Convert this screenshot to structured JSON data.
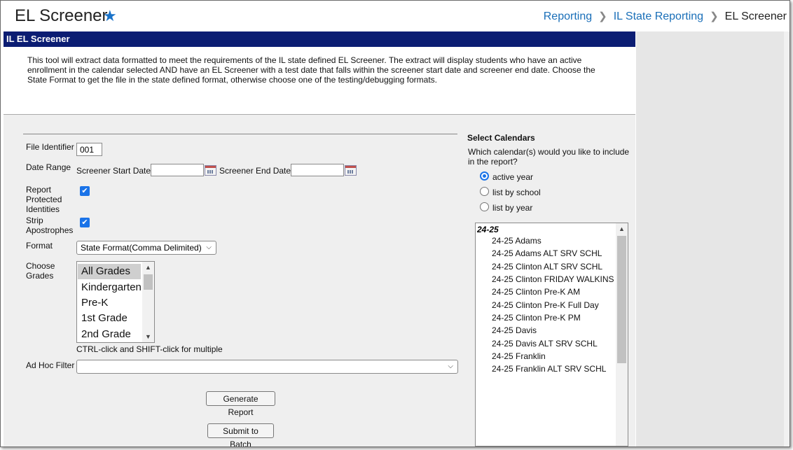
{
  "header": {
    "title": "EL Screener",
    "breadcrumb": [
      "Reporting",
      "IL State Reporting",
      "EL Screener"
    ]
  },
  "panel": {
    "title": "IL EL Screener",
    "description": "This tool will extract data formatted to meet the requirements of the IL state defined EL Screener. The extract will display students who have an active enrollment in the calendar selected AND have an EL Screener with a test date that falls within the screener start date and screener end date. Choose the State Format to get the file in the state defined format, otherwise choose one of the testing/debugging formats."
  },
  "form": {
    "file_identifier_label": "File Identifier",
    "file_identifier_value": "001",
    "date_range_label": "Date Range",
    "start_date_label": "Screener Start Date",
    "start_date_value": "",
    "end_date_label": "Screener End Date",
    "end_date_value": "",
    "protected_label_1": "Report",
    "protected_label_2": "Protected",
    "protected_label_3": "Identities",
    "protected_checked": true,
    "strip_label_1": "Strip",
    "strip_label_2": "Apostrophes",
    "strip_checked": true,
    "format_label": "Format",
    "format_value": "State Format(Comma Delimited)",
    "grades_label_1": "Choose",
    "grades_label_2": "Grades",
    "grades": [
      "All Grades",
      "Kindergarten",
      "Pre-K",
      "1st Grade",
      "2nd Grade"
    ],
    "grades_selected": "All Grades",
    "grades_hint": "CTRL-click and SHIFT-click for multiple",
    "adhoc_label": "Ad Hoc Filter",
    "adhoc_value": "",
    "generate_button": "Generate Report",
    "batch_button": "Submit to Batch"
  },
  "calendars": {
    "title": "Select Calendars",
    "question_1": "Which calendar(s) would you like to include",
    "question_2": "in the report?",
    "options": [
      "active year",
      "list by school",
      "list by year"
    ],
    "selected_option": "active year",
    "group": "24-25",
    "items": [
      "24-25 Adams",
      "24-25 Adams ALT SRV SCHL",
      "24-25 Clinton ALT SRV SCHL",
      "24-25 Clinton FRIDAY WALKINS",
      "24-25 Clinton Pre-K AM",
      "24-25 Clinton Pre-K Full Day",
      "24-25 Clinton Pre-K PM",
      "24-25 Davis",
      "24-25 Davis ALT SRV SCHL",
      "24-25 Franklin",
      "24-25 Franklin ALT SRV SCHL"
    ]
  },
  "colors": {
    "title_bar": "#0b1d73",
    "link": "#1a6fb8",
    "accent": "#1a73e8"
  }
}
